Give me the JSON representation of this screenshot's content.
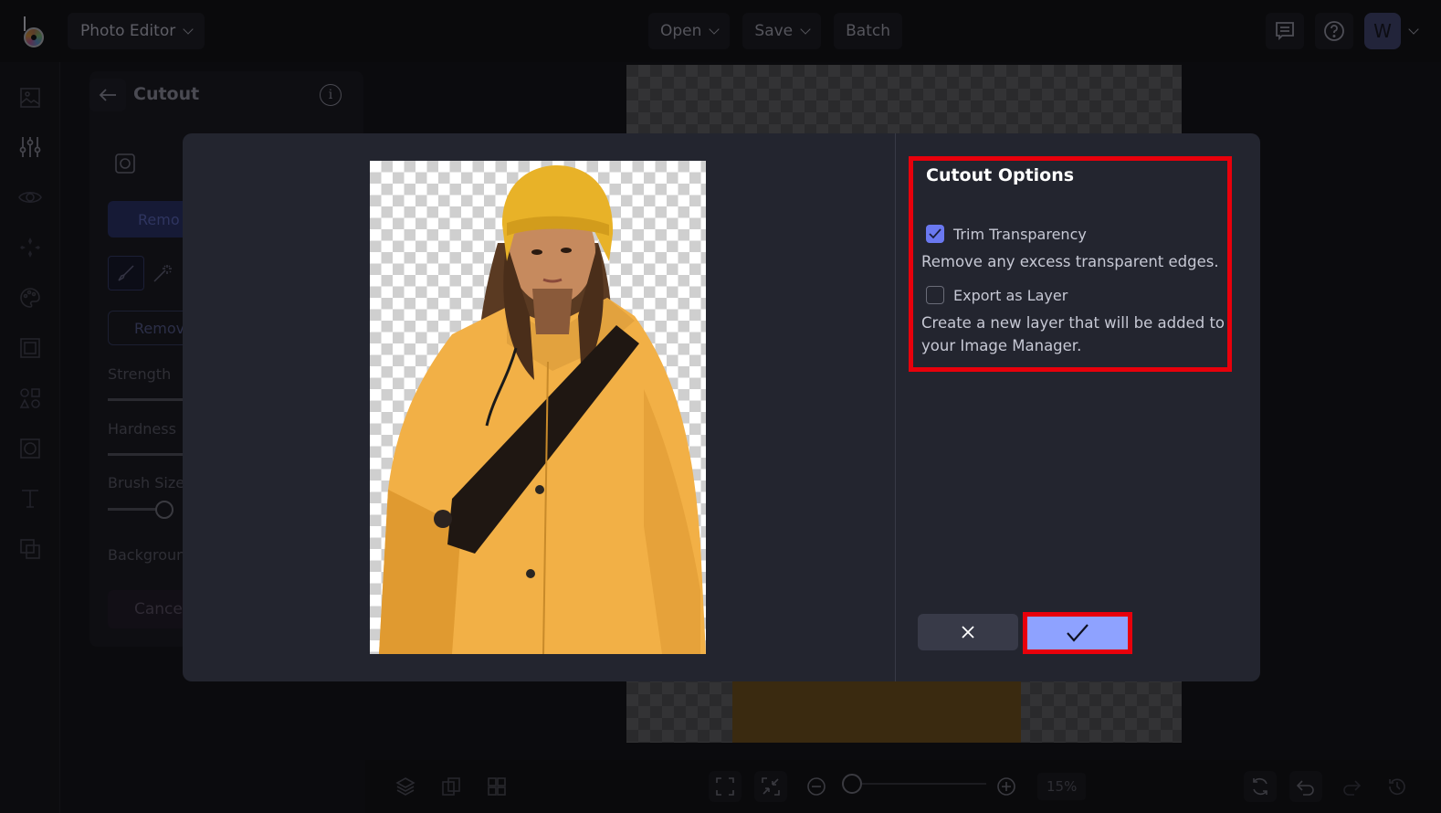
{
  "topbar": {
    "app_menu_label": "Photo Editor",
    "open_label": "Open",
    "save_label": "Save",
    "batch_label": "Batch",
    "icons": [
      "logo-icon",
      "chat-icon",
      "help-icon"
    ],
    "avatar_initial": "W"
  },
  "rail": {
    "items": [
      "image-icon",
      "adjustments-icon",
      "eye-icon",
      "sparkle-icon",
      "palette-icon",
      "frame-icon",
      "shapes-icon",
      "texture-icon",
      "text-icon",
      "overlay-icon"
    ]
  },
  "tool_panel": {
    "title": "Cutout",
    "remove_bg_button": "Remo",
    "remove_button_2": "Remov",
    "strength_label": "Strength",
    "hardness_label": "Hardness",
    "brush_size_label": "Brush Size",
    "background_label": "Backgroun",
    "cancel_label": "Cance"
  },
  "bottombar": {
    "zoom_percent": "15%",
    "zoom_level_fraction": 0.08
  },
  "modal": {
    "options_title": "Cutout Options",
    "trim_transparency": {
      "label": "Trim Transparency",
      "checked": true,
      "description": "Remove any excess transparent edges."
    },
    "export_as_layer": {
      "label": "Export as Layer",
      "checked": false,
      "description": "Create a new layer that will be added to your Image Manager."
    },
    "cancel_icon": "close-icon",
    "confirm_icon": "check-icon",
    "accent_color": "#8ea2ff",
    "highlight_color": "#e8000b"
  }
}
